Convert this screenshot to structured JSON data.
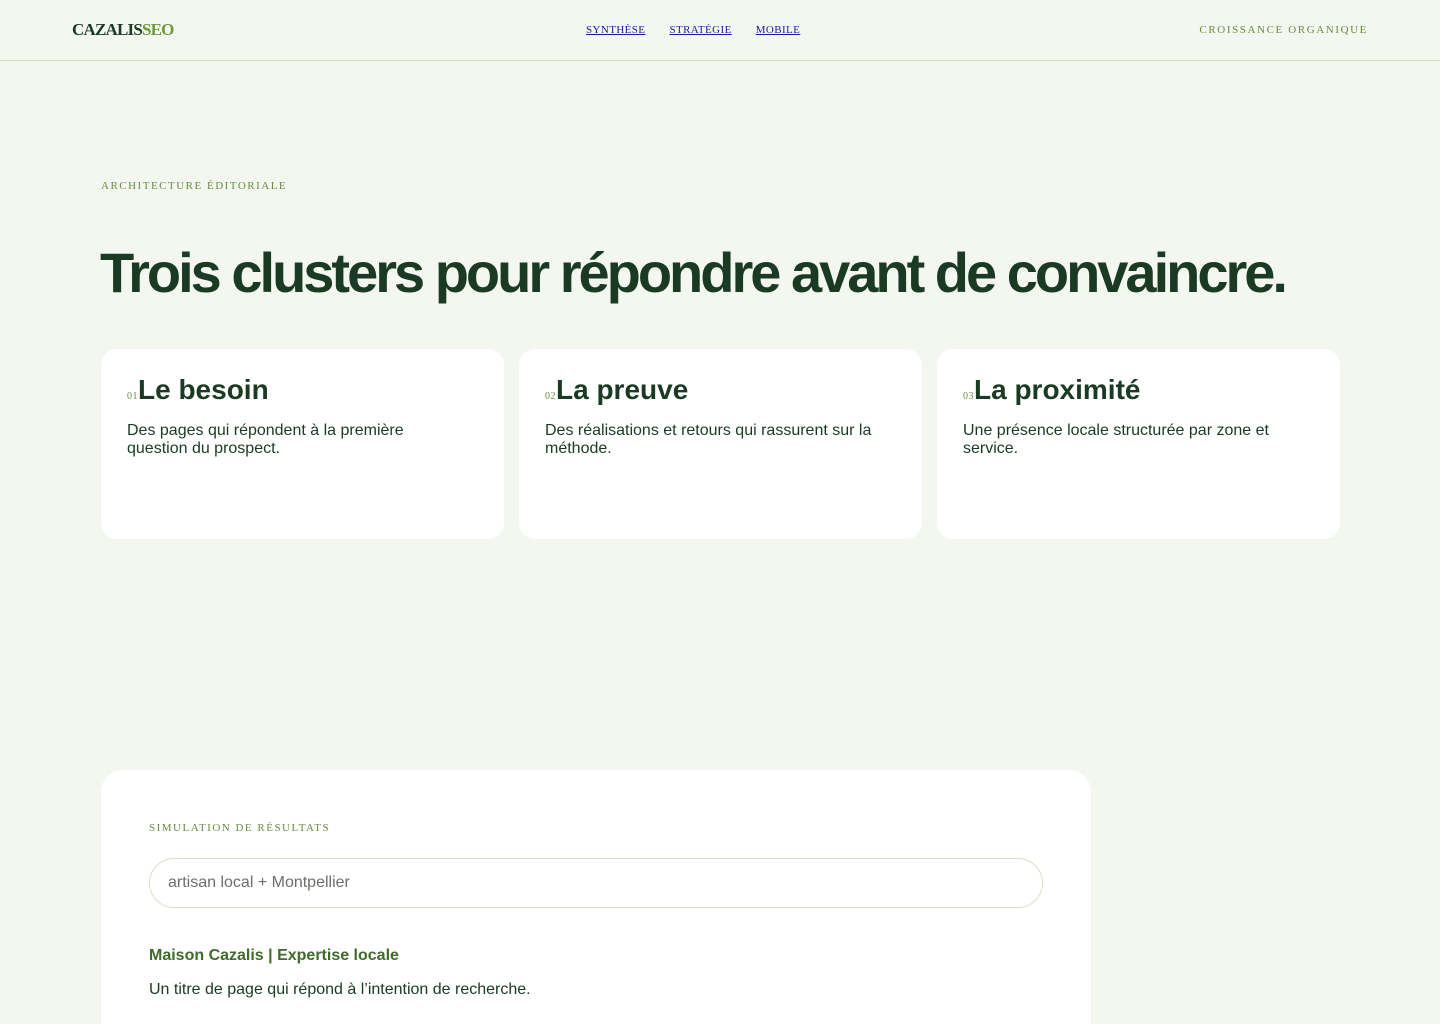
{
  "header": {
    "brand_main": "CAZALIS",
    "brand_accent": "SEO",
    "nav": [
      {
        "label": "SYNTHÈSE"
      },
      {
        "label": "STRATÉGIE"
      },
      {
        "label": "MOBILE"
      }
    ],
    "tagline": "CROISSANCE ORGANIQUE"
  },
  "section": {
    "eyebrow": "ARCHITECTURE ÉDITORIALE",
    "headline": "Trois clusters pour répondre avant de convaincre."
  },
  "clusters": [
    {
      "num": "01",
      "title": "Le besoin",
      "text": "Des pages qui répondent à la première question du prospect."
    },
    {
      "num": "02",
      "title": "La preuve",
      "text": "Des réalisations et retours qui rassurent sur la méthode."
    },
    {
      "num": "03",
      "title": "La proximité",
      "text": "Une présence locale structurée par zone et service."
    }
  ],
  "simulation": {
    "eyebrow": "SIMULATION DE RÉSULTATS",
    "search_placeholder": "artisan local + Montpellier",
    "search_value": "",
    "result_title": "Maison Cazalis | Expertise locale",
    "result_description": "Un titre de page qui répond à l’intention de recherche."
  },
  "colors": {
    "background": "#f4f7ef",
    "ink": "#1b3a24",
    "accent": "#6a8a45",
    "card": "#ffffff"
  }
}
